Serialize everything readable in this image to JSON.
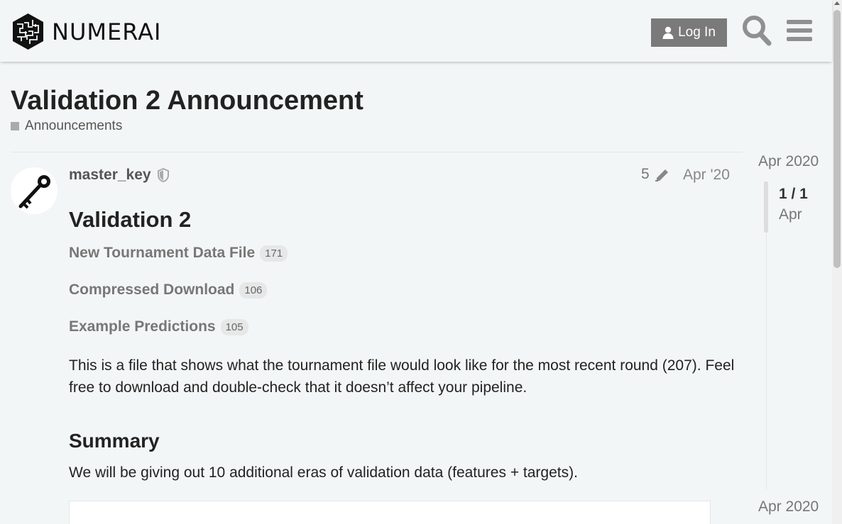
{
  "header": {
    "logo_text": "NUMERAI",
    "login_label": "Log In",
    "icons": [
      "user-icon",
      "search-icon",
      "hamburger-menu-icon"
    ]
  },
  "topic": {
    "title": "Validation 2 Announcement",
    "category": "Announcements",
    "category_color": "#aaaaaa"
  },
  "post": {
    "username": "master_key",
    "edit_count": "5",
    "date": "Apr '20",
    "heading": "Validation 2",
    "links": [
      {
        "label": "New Tournament Data File",
        "clicks": "171"
      },
      {
        "label": "Compressed Download",
        "clicks": "106"
      },
      {
        "label": "Example Predictions",
        "clicks": "105"
      }
    ],
    "paragraph": "This is a file that shows what the tournament file would look like for the most recent round (207). Feel free to download and double-check that it doesn’t affect your pipeline.",
    "summary_heading": "Summary",
    "summary_text": "We will be giving out 10 additional eras of validation data (features + targets)."
  },
  "timeline": {
    "start": "Apr 2020",
    "position": "1 / 1",
    "current_month": "Apr",
    "end": "Apr 2020"
  }
}
